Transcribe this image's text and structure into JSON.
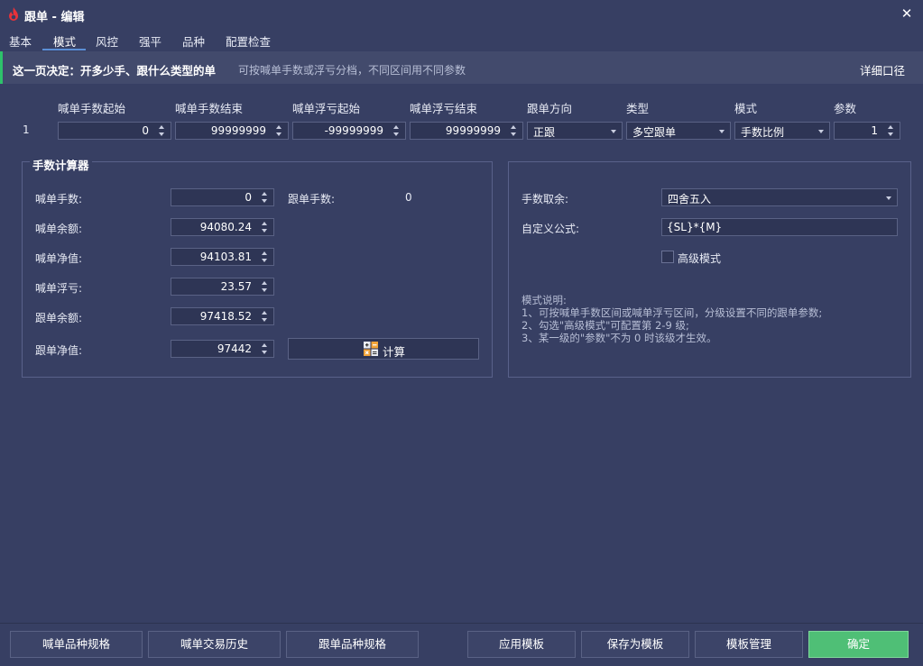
{
  "window": {
    "title": "跟单 - 编辑",
    "close_glyph": "✕"
  },
  "tabs": [
    {
      "label": "基本"
    },
    {
      "label": "模式"
    },
    {
      "label": "风控"
    },
    {
      "label": "强平"
    },
    {
      "label": "品种"
    },
    {
      "label": "配置检查"
    }
  ],
  "active_tab": "模式",
  "banner": {
    "main": "这一页决定：开多少手、跟什么类型的单",
    "sub": "可按喊单手数或浮亏分档，不同区间用不同参数",
    "link": "详细口径"
  },
  "grid": {
    "headers": [
      "喊单手数起始",
      "喊单手数结束",
      "喊单浮亏起始",
      "喊单浮亏结束",
      "跟单方向",
      "类型",
      "模式",
      "参数"
    ],
    "row_index": "1",
    "lots_start": "0",
    "lots_end": "99999999",
    "float_start": "-99999999",
    "float_end": "99999999",
    "direction": "正跟",
    "type": "多空跟单",
    "mode": "手数比例",
    "param": "1"
  },
  "calculator": {
    "title": "手数计算器",
    "caller_lots_label": "喊单手数:",
    "caller_lots": "0",
    "follow_lots_label": "跟单手数:",
    "follow_lots": "0",
    "caller_balance_label": "喊单余额:",
    "caller_balance": "94080.24",
    "caller_equity_label": "喊单净值:",
    "caller_equity": "94103.81",
    "caller_float_label": "喊单浮亏:",
    "caller_float": "23.57",
    "follow_balance_label": "跟单余额:",
    "follow_balance": "97418.52",
    "follow_equity_label": "跟单净值:",
    "follow_equity": "97442",
    "calc_button": "计算"
  },
  "options": {
    "rounding_label": "手数取余:",
    "rounding": "四舍五入",
    "formula_label": "自定义公式:",
    "formula": "{SL}*{M}",
    "advanced_label": "高级模式",
    "advanced_checked": false,
    "notes": [
      "模式说明:",
      "1、可按喊单手数区间或喊单浮亏区间，分级设置不同的跟单参数;",
      "2、勾选\"高级模式\"可配置第 2-9 级;",
      "3、某一级的\"参数\"不为 0 时该级才生效。"
    ]
  },
  "footer": {
    "caller_spec": "喊单品种规格",
    "caller_history": "喊单交易历史",
    "follow_spec": "跟单品种规格",
    "apply_template": "应用模板",
    "save_template": "保存为模板",
    "manage_template": "模板管理",
    "confirm": "确定"
  },
  "colors": {
    "background": "#373f63",
    "accent": "#4fbf76",
    "banner_stripe": "#2ec26b",
    "tab_underline": "#5b8fd6"
  }
}
